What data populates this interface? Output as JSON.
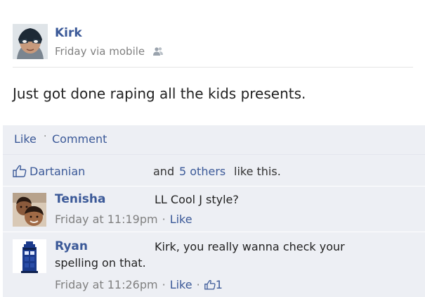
{
  "post": {
    "author": "Kirk",
    "time": "Friday",
    "via": "via mobile",
    "text": "Just got done raping all the kids presents."
  },
  "actions": {
    "like": "Like",
    "separator": "·",
    "comment": "Comment"
  },
  "likes": {
    "liker": "Dartanian",
    "and": "and",
    "others_link": "5 others",
    "like_this": "like this."
  },
  "comments": [
    {
      "author": "Tenisha",
      "text": "LL Cool J style?",
      "time": "Friday at 11:19pm",
      "like": "Like"
    },
    {
      "author": "Ryan",
      "text_line1": "Kirk, you really wanna check your",
      "text_line2": "spelling on that.",
      "time": "Friday at 11:26pm",
      "like": "Like",
      "like_count": "1"
    }
  ],
  "icons": {
    "friends": "friends-icon",
    "thumbs_up": "thumbs-up-icon"
  },
  "colors": {
    "link": "#3b5998",
    "feedback_bg": "#edeff4",
    "meta": "#808080"
  }
}
